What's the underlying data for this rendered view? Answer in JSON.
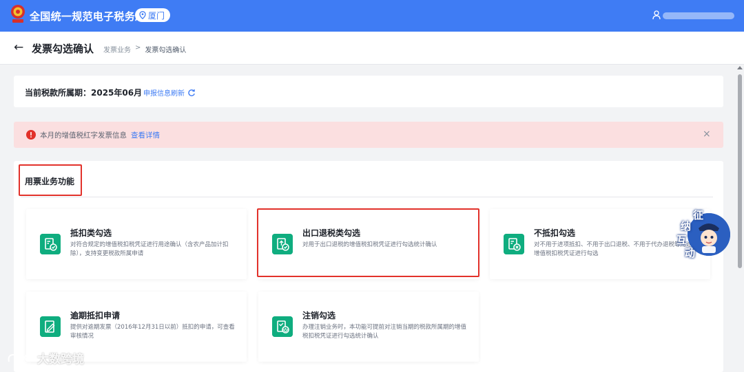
{
  "header": {
    "title": "全国统一规范电子税务局",
    "city": "厦门",
    "user_name": ""
  },
  "page": {
    "back_label": "←",
    "title": "发票勾选确认",
    "breadcrumb": [
      "发票业务",
      "发票勾选确认"
    ]
  },
  "period": {
    "label": "当前税款所属期：2025年06月",
    "refresh_label": "申报信息刷新"
  },
  "alert": {
    "text": "本月的增值税红字发票信息",
    "link": "查看详情",
    "close": "×"
  },
  "section": {
    "title": "用票业务功能"
  },
  "cards": [
    {
      "title": "抵扣类勾选",
      "desc": "对符合规定的增值税扣税凭证进行用途确认（含农产品加计扣除），支持变更税款所属申请",
      "icon": "deduct-check-icon"
    },
    {
      "title": "出口退税类勾选",
      "desc": "对用于出口退税的增值税扣税凭证进行勾选统计确认",
      "icon": "export-refund-icon"
    },
    {
      "title": "不抵扣勾选",
      "desc": "对不用于进项抵扣、不用于出口退税、不用于代办退税等用途的增值税扣税凭证进行勾选",
      "icon": "no-deduct-icon"
    },
    {
      "title": "逾期抵扣申请",
      "desc": "提供对逾期发票（2016年12月31日以前）抵扣的申请，可查看审核情况",
      "icon": "overdue-apply-icon"
    },
    {
      "title": "注销勾选",
      "desc": "办理注销业务时，本功能可提前对注销当期的税款所属期的增值税扣税凭证进行勾选统计确认",
      "icon": "cancel-check-icon"
    }
  ],
  "assistant": {
    "chars": [
      "征",
      "纳",
      "互",
      "动"
    ]
  },
  "watermark": {
    "text": "大数跨境"
  },
  "colors": {
    "brand_blue": "#3f7cf4",
    "card_icon_green": "#0fad7f",
    "highlight_red": "#e2312a",
    "alert_bg": "#fbdfe0"
  }
}
